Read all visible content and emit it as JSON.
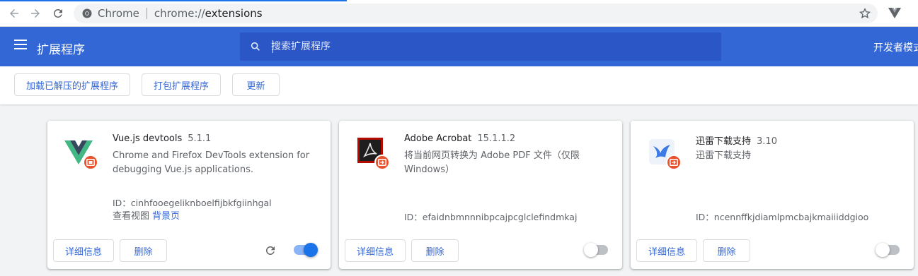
{
  "browser": {
    "site_label": "Chrome",
    "url_scheme": "chrome://",
    "url_host": "extensions"
  },
  "header": {
    "title": "扩展程序",
    "search_placeholder": "搜索扩展程序",
    "dev_mode_label": "开发者模式"
  },
  "toolbar": {
    "load_unpacked": "加载已解压的扩展程序",
    "pack": "打包扩展程序",
    "update": "更新"
  },
  "cards": [
    {
      "name": "Vue.js devtools",
      "version": "5.1.1",
      "description": "Chrome and Firefox DevTools extension for debugging Vue.js applications.",
      "id_text": "ID：cinhfooegeliknboelfijbkfgiinhgal",
      "views_label": "查看视图",
      "views_link": "背景页",
      "details": "详细信息",
      "remove": "删除",
      "enabled": true
    },
    {
      "name": "Adobe Acrobat",
      "version": "15.1.1.2",
      "description": "将当前网页转换为 Adobe PDF 文件（仅限 Windows）",
      "id_text": "ID：efaidnbmnnnibpcajpcglclefindmkaj",
      "details": "详细信息",
      "remove": "删除",
      "enabled": false
    },
    {
      "name": "迅雷下载支持",
      "version": "3.10",
      "description": "迅雷下载支持",
      "id_text": "ID：ncennffkjdiamlpmcbajkmaiiiddgioo",
      "details": "详细信息",
      "remove": "删除",
      "enabled": false
    }
  ],
  "colors": {
    "header_bg": "#3367d6",
    "accent": "#1a73e8",
    "badge": "#e8522f"
  }
}
